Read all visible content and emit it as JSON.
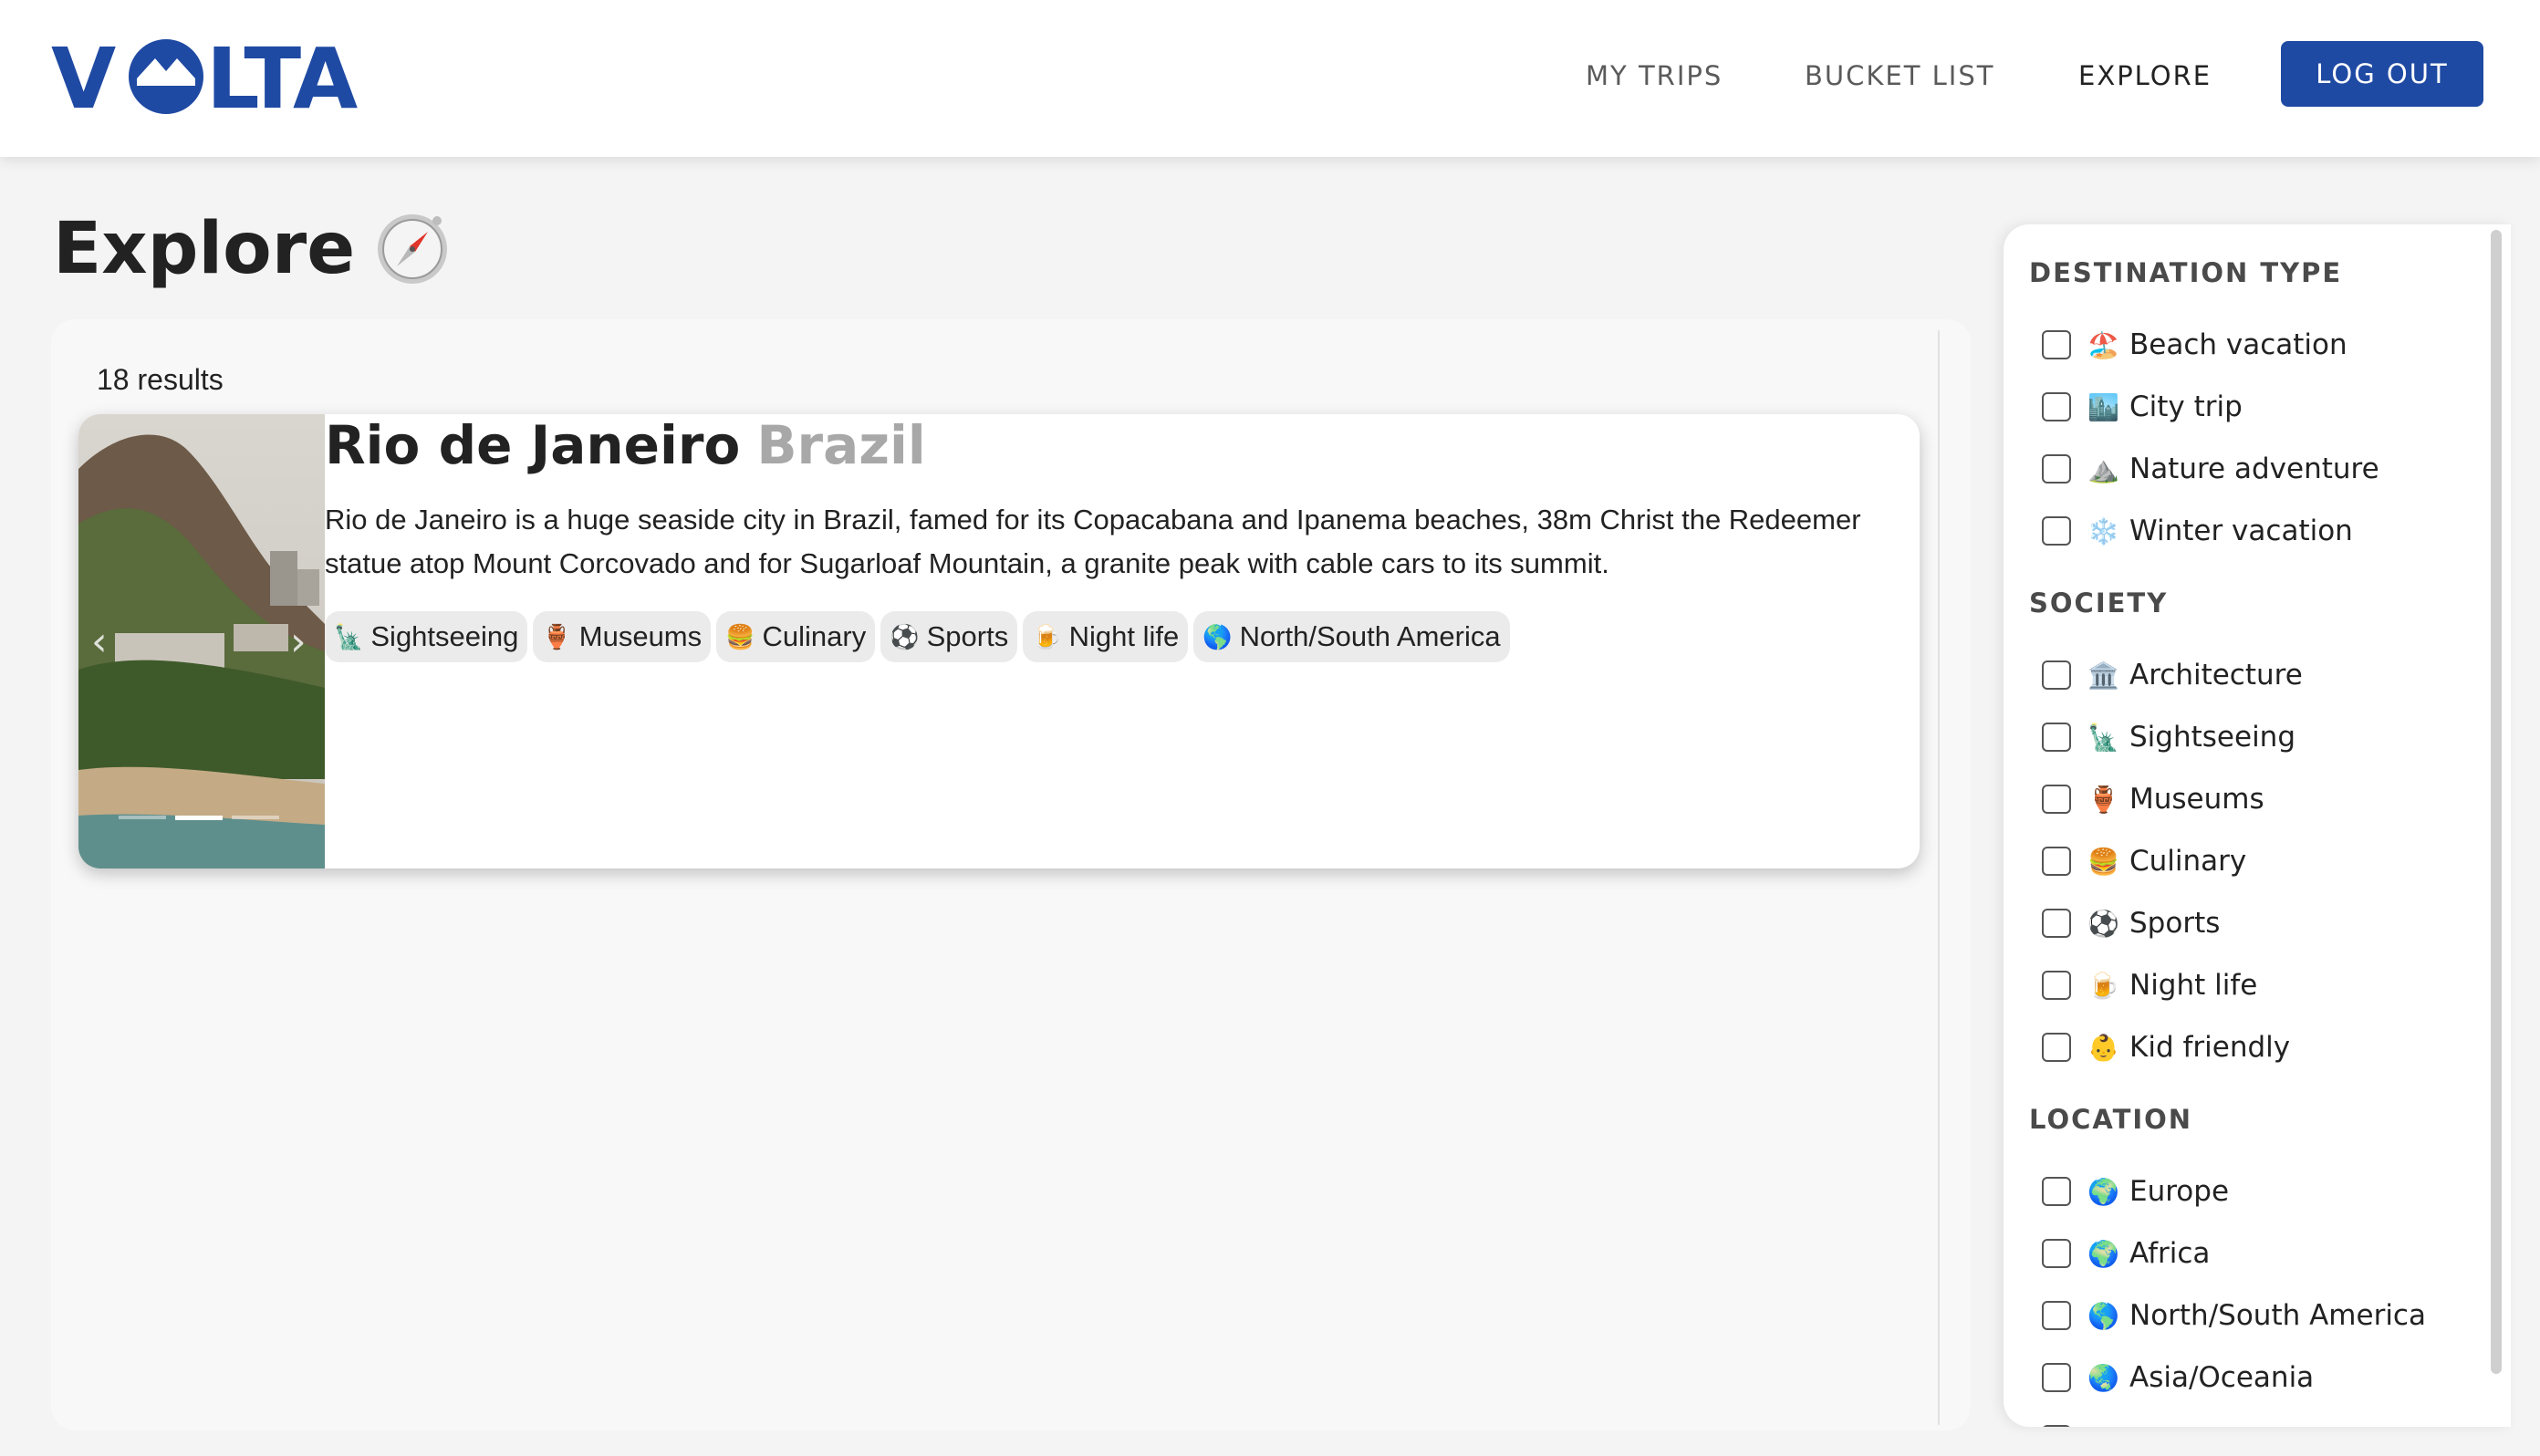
{
  "header": {
    "logo_text": "VOLTA",
    "nav": [
      {
        "label": "MY TRIPS"
      },
      {
        "label": "BUCKET LIST"
      },
      {
        "label": "EXPLORE"
      }
    ],
    "logout_label": "LOG OUT",
    "brand_color": "#1f4aa3"
  },
  "page": {
    "title": "Explore",
    "title_icon": "compass-icon"
  },
  "results": {
    "count_label": "18 results",
    "cards": [
      {
        "city": "Rio de Janeiro",
        "country": "Brazil",
        "description": "Rio de Janeiro is a huge seaside city in Brazil, famed for its Copacabana and Ipanema beaches, 38m Christ the Redeemer statue atop Mount Corcovado and for Sugarloaf Mountain, a granite peak with cable cars to its summit.",
        "carousel": {
          "prev": "‹",
          "next": "›",
          "slides": 3,
          "active_slide": 2
        },
        "tags": [
          {
            "icon": "🗽",
            "label": "Sightseeing"
          },
          {
            "icon": "🏺",
            "label": "Museums"
          },
          {
            "icon": "🍔",
            "label": "Culinary"
          },
          {
            "icon": "⚽",
            "label": "Sports"
          },
          {
            "icon": "🍺",
            "label": "Night life"
          },
          {
            "icon": "🌎",
            "label": "North/South America"
          }
        ]
      }
    ]
  },
  "filters": {
    "sections": [
      {
        "heading": "DESTINATION TYPE",
        "items": [
          {
            "icon": "🏖️",
            "label": "Beach vacation",
            "checked": false
          },
          {
            "icon": "🏙️",
            "label": "City trip",
            "checked": false
          },
          {
            "icon": "⛰️",
            "label": "Nature adventure",
            "checked": false
          },
          {
            "icon": "❄️",
            "label": "Winter vacation",
            "checked": false
          }
        ]
      },
      {
        "heading": "SOCIETY",
        "items": [
          {
            "icon": "🏛️",
            "label": "Architecture",
            "checked": false
          },
          {
            "icon": "🗽",
            "label": "Sightseeing",
            "checked": false
          },
          {
            "icon": "🏺",
            "label": "Museums",
            "checked": false
          },
          {
            "icon": "🍔",
            "label": "Culinary",
            "checked": false
          },
          {
            "icon": "⚽",
            "label": "Sports",
            "checked": false
          },
          {
            "icon": "🍺",
            "label": "Night life",
            "checked": false
          },
          {
            "icon": "👶",
            "label": "Kid friendly",
            "checked": false
          }
        ]
      },
      {
        "heading": "LOCATION",
        "items": [
          {
            "icon": "🌍",
            "label": "Europe",
            "checked": false
          },
          {
            "icon": "🌍",
            "label": "Africa",
            "checked": false
          },
          {
            "icon": "🌎",
            "label": "North/South America",
            "checked": false
          },
          {
            "icon": "🌏",
            "label": "Asia/Oceania",
            "checked": false
          }
        ]
      }
    ]
  }
}
